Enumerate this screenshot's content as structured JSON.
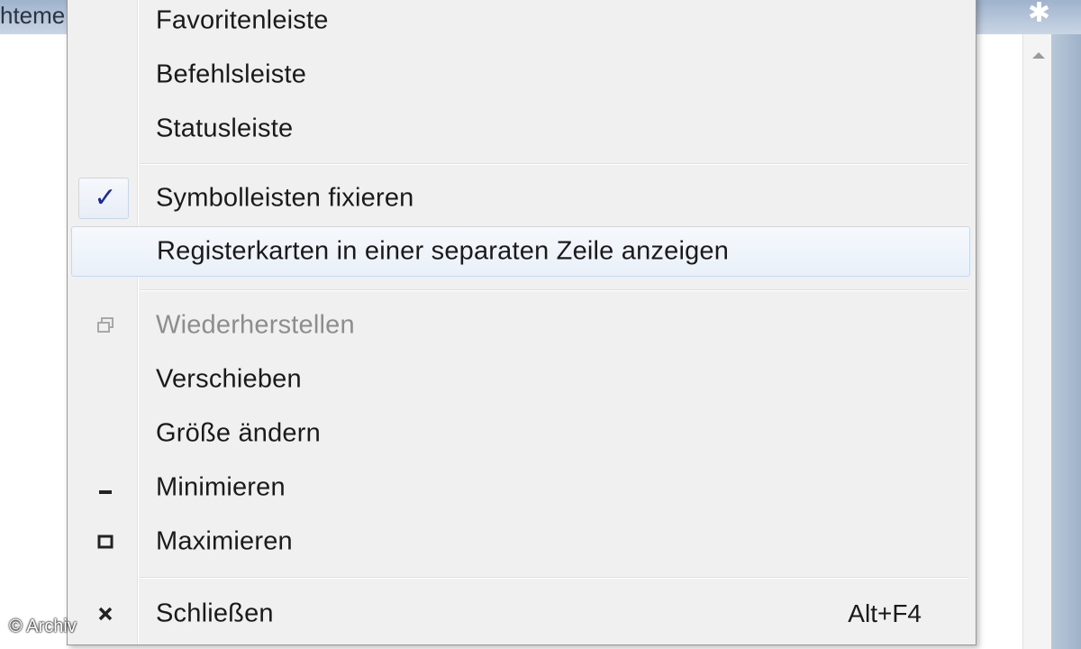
{
  "window": {
    "title_partial": "hteme",
    "gear_icon": "gear-icon"
  },
  "menu": {
    "items": [
      {
        "label": "Favoritenleiste"
      },
      {
        "label": "Befehlsleiste"
      },
      {
        "label": "Statusleiste"
      },
      {
        "label": "Symbolleisten fixieren",
        "icon": "checkmark-icon",
        "checked": true
      },
      {
        "label": "Registerkarten in einer separaten Zeile anzeigen",
        "highlighted": true
      },
      {
        "label": "Wiederherstellen",
        "icon": "restore-icon",
        "disabled": true
      },
      {
        "label": "Verschieben"
      },
      {
        "label": "Größe ändern"
      },
      {
        "label": "Minimieren",
        "icon": "minimize-icon"
      },
      {
        "label": "Maximieren",
        "icon": "maximize-icon"
      },
      {
        "label": "Schließen",
        "icon": "close-icon",
        "shortcut": "Alt+F4"
      }
    ]
  },
  "watermark": "© Archiv"
}
